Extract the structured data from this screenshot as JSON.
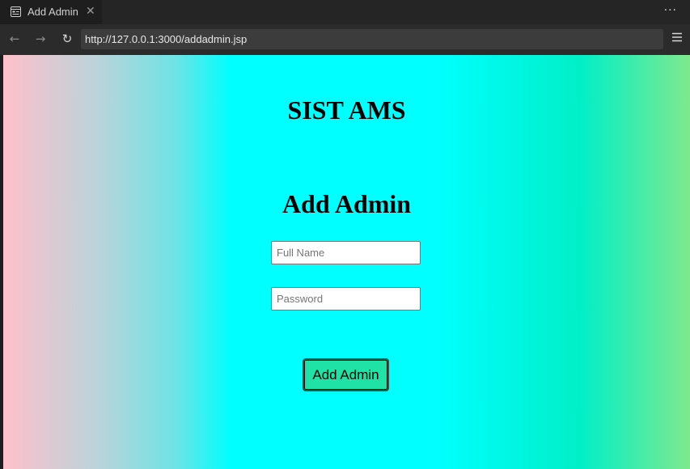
{
  "browser": {
    "tab_title": "Add Admin",
    "tab_close": "✕",
    "more_menu": "···",
    "url": "http://127.0.0.1:3000/addadmin.jsp",
    "icons": {
      "tab": "page-icon",
      "back": "arrow-left-icon",
      "forward": "arrow-right-icon",
      "reload": "reload-icon",
      "menu": "hamburger-menu-icon"
    }
  },
  "page": {
    "site_title": "SIST AMS",
    "form_heading": "Add Admin",
    "fields": {
      "full_name": {
        "placeholder": "Full Name",
        "value": ""
      },
      "password": {
        "placeholder": "Password",
        "value": ""
      }
    },
    "submit_label": "Add Admin",
    "colors": {
      "gradient": [
        "#ffc0cb",
        "#00ffff",
        "#00efc8",
        "#7fe98e"
      ],
      "button": "#1fe3a6"
    }
  }
}
